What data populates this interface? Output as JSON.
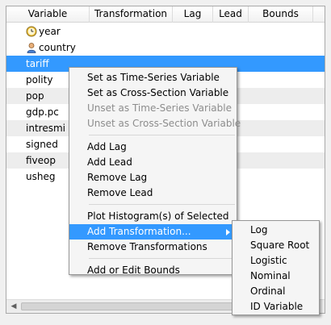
{
  "columns": [
    "Variable",
    "Transformation",
    "Lag",
    "Lead",
    "Bounds"
  ],
  "rows": [
    {
      "name": "year",
      "icon": "clock-icon"
    },
    {
      "name": "country",
      "icon": "person-icon"
    },
    {
      "name": "tariff",
      "icon": null
    },
    {
      "name": "polity",
      "icon": null
    },
    {
      "name": "pop",
      "icon": null
    },
    {
      "name": "gdp.pc",
      "icon": null
    },
    {
      "name": "intresmi",
      "icon": null
    },
    {
      "name": "signed",
      "icon": null
    },
    {
      "name": "fiveop",
      "icon": null
    },
    {
      "name": "usheg",
      "icon": null
    }
  ],
  "selected_row": "tariff",
  "context_menu": {
    "group1": [
      {
        "label": "Set as Time-Series Variable",
        "enabled": true
      },
      {
        "label": "Set as Cross-Section Variable",
        "enabled": true
      },
      {
        "label": "Unset as Time-Series Variable",
        "enabled": false
      },
      {
        "label": "Unset as Cross-Section Variable",
        "enabled": false
      }
    ],
    "group2": [
      {
        "label": "Add Lag",
        "enabled": true
      },
      {
        "label": "Add Lead",
        "enabled": true
      },
      {
        "label": "Remove Lag",
        "enabled": true
      },
      {
        "label": "Remove Lead",
        "enabled": true
      }
    ],
    "group3": [
      {
        "label": "Plot Histogram(s) of Selected",
        "enabled": true
      },
      {
        "label": "Add Transformation...",
        "enabled": true,
        "highlighted": true,
        "has_submenu": true
      },
      {
        "label": "Remove Transformations",
        "enabled": true
      }
    ],
    "group4": [
      {
        "label": "Add or Edit Bounds",
        "enabled": true
      }
    ]
  },
  "transformation_submenu": [
    "Log",
    "Square Root",
    "Logistic",
    "Nominal",
    "Ordinal",
    "ID Variable"
  ],
  "colors": {
    "selection": "#3399ff",
    "alt_row": "#ededed",
    "disabled_text": "#8d8d8d"
  }
}
